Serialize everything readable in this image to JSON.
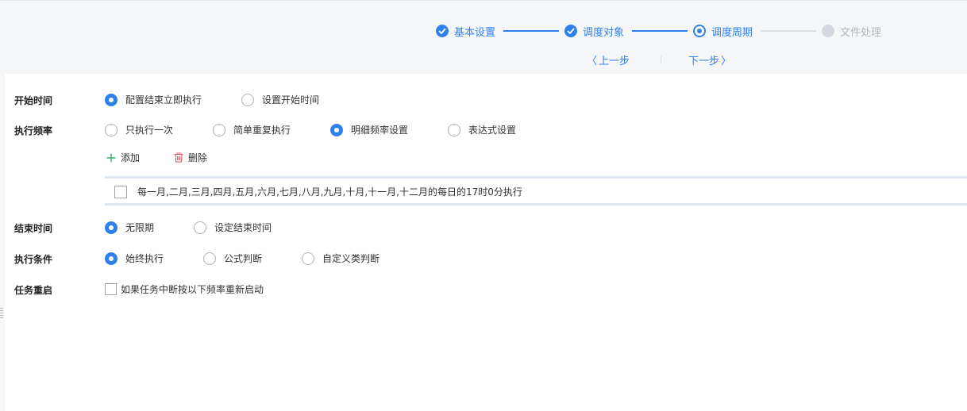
{
  "stepper": {
    "steps": [
      {
        "label": "基本设置",
        "state": "done"
      },
      {
        "label": "调度对象",
        "state": "done"
      },
      {
        "label": "调度周期",
        "state": "current"
      },
      {
        "label": "文件处理",
        "state": "pending"
      }
    ],
    "prev_label": "上一步",
    "next_label": "下一步"
  },
  "form": {
    "start_time": {
      "label": "开始时间",
      "options": [
        "配置结束立即执行",
        "设置开始时间"
      ],
      "selected": 0
    },
    "frequency": {
      "label": "执行频率",
      "options": [
        "只执行一次",
        "简单重复执行",
        "明细频率设置",
        "表达式设置"
      ],
      "selected": 2,
      "add_label": "添加",
      "delete_label": "删除",
      "rules": [
        "每一月,二月,三月,四月,五月,六月,七月,八月,九月,十月,十一月,十二月的每日的17时0分执行"
      ]
    },
    "end_time": {
      "label": "结束时间",
      "options": [
        "无限期",
        "设定结束时间"
      ],
      "selected": 0
    },
    "condition": {
      "label": "执行条件",
      "options": [
        "始终执行",
        "公式判断",
        "自定义类判断"
      ],
      "selected": 0
    },
    "restart": {
      "label": "任务重启",
      "checkbox_label": "如果任务中断按以下频率重新启动",
      "checked": false
    }
  },
  "colors": {
    "accent": "#2f80ed",
    "header_bg": "#f5f6f8",
    "pending": "#d5d8de",
    "add_icon": "#3bb36b",
    "delete_icon": "#e0555a"
  },
  "icons": {
    "step_done": "check-icon",
    "prev": "chevron-left-icon",
    "next": "chevron-right-icon",
    "add": "plus-icon",
    "delete": "trash-icon"
  }
}
